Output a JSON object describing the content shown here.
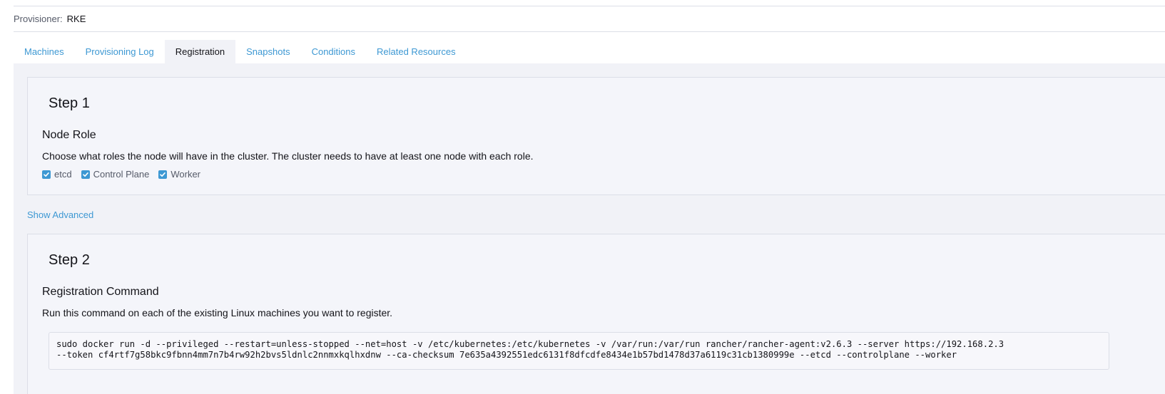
{
  "provisioner": {
    "label": "Provisioner:",
    "value": "RKE"
  },
  "tabs": [
    {
      "label": "Machines",
      "active": false
    },
    {
      "label": "Provisioning Log",
      "active": false
    },
    {
      "label": "Registration",
      "active": true
    },
    {
      "label": "Snapshots",
      "active": false
    },
    {
      "label": "Conditions",
      "active": false
    },
    {
      "label": "Related Resources",
      "active": false
    }
  ],
  "step1": {
    "title": "Step 1",
    "section_title": "Node Role",
    "description": "Choose what roles the node will have in the cluster. The cluster needs to have at least one node with each role.",
    "roles": [
      {
        "label": "etcd",
        "checked": true
      },
      {
        "label": "Control Plane",
        "checked": true
      },
      {
        "label": "Worker",
        "checked": true
      }
    ]
  },
  "show_advanced": "Show Advanced",
  "step2": {
    "title": "Step 2",
    "section_title": "Registration Command",
    "description": "Run this command on each of the existing Linux machines you want to register.",
    "command_line1": "sudo docker run -d --privileged --restart=unless-stopped --net=host -v /etc/kubernetes:/etc/kubernetes -v /var/run:/var/run rancher/rancher-agent:v2.6.3 --server https://192.168.2.3",
    "command_line2": "--token cf4rtf7g58bkc9fbnn4mm7n7b4rw92h2bvs5ldnlc2nnmxkqlhxdnw --ca-checksum 7e635a4392551edc6131f8dfcdfe8434e1b57bd1478d37a6119c31cb1380999e --etcd --controlplane --worker"
  },
  "colors": {
    "accent": "#3d98d3",
    "tab_body_background": "#f1f2f7",
    "border": "#dcdee7"
  },
  "icons": {
    "checkbox_checked": "check-icon"
  }
}
